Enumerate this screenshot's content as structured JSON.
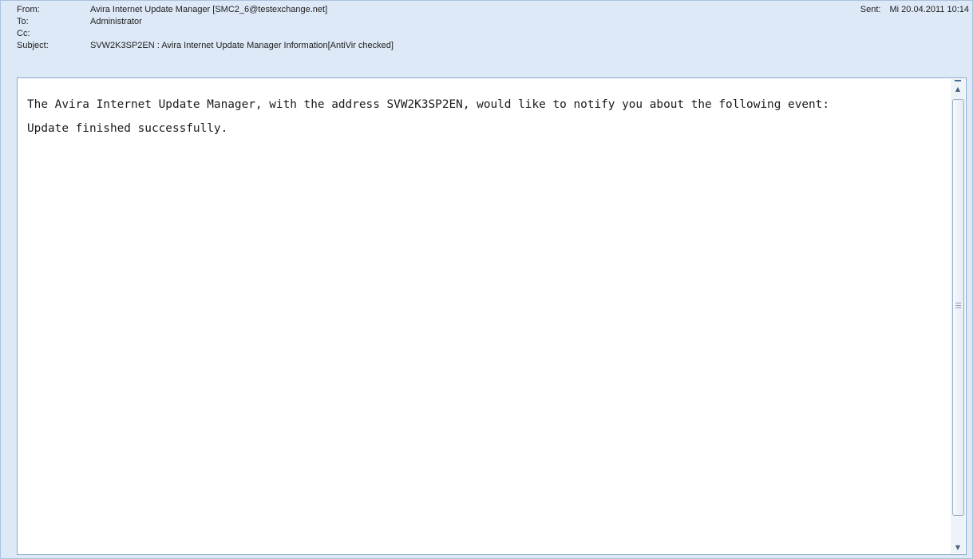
{
  "header": {
    "from_label": "From:",
    "from_value": "Avira Internet Update Manager [SMC2_6@testexchange.net]",
    "to_label": "To:",
    "to_value": "Administrator",
    "cc_label": "Cc:",
    "cc_value": "",
    "subject_label": "Subject:",
    "subject_value": "SVW2K3SP2EN : Avira Internet Update Manager Information[AntiVir checked]",
    "sent_label": "Sent:",
    "sent_value": "Mi 20.04.2011 10:14"
  },
  "body": {
    "line1": "The Avira Internet Update Manager, with the address SVW2K3SP2EN, would like to notify you about the following event:",
    "line2": "Update finished successfully."
  },
  "scrollbar": {
    "up_icon": "scroll-up-arrow",
    "down_icon": "scroll-down-arrow"
  }
}
